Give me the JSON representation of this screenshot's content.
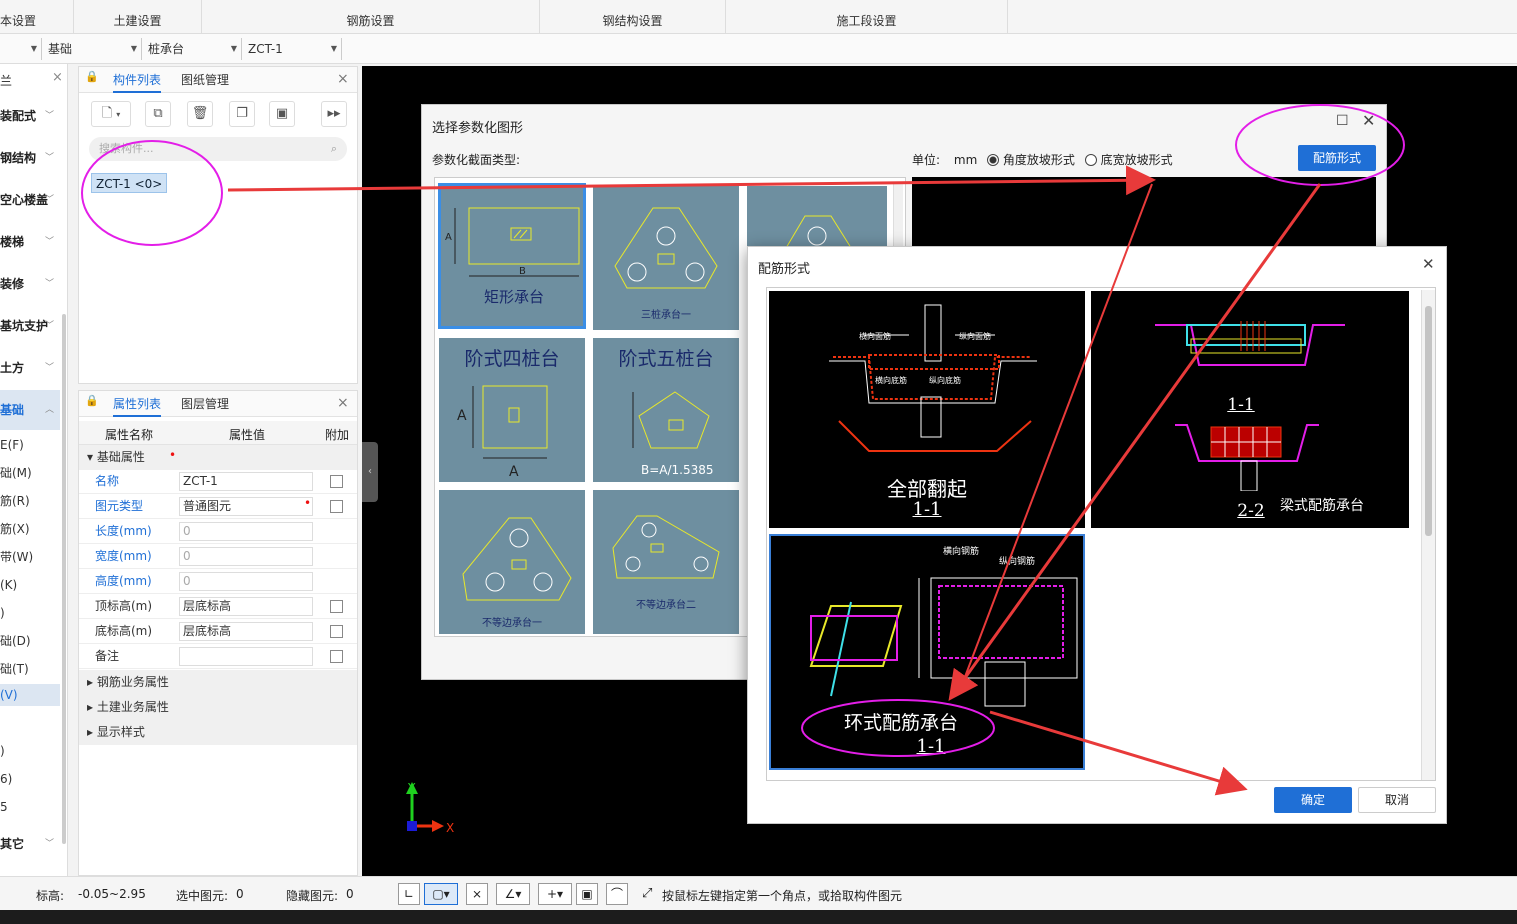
{
  "top_tabs": [
    "本设置",
    "土建设置",
    "钢筋设置",
    "钢结构设置",
    "施工段设置"
  ],
  "selectors": [
    "基础",
    "桩承台",
    "ZCT-1"
  ],
  "leftnav": {
    "headers": [
      "装配式",
      "钢结构",
      "空心楼盖",
      "楼梯",
      "装修",
      "基坑支护",
      "土方",
      "基础",
      "其它"
    ],
    "sub_items": [
      "E(F)",
      "础(M)",
      "筋(R)",
      "筋(X)",
      "带(W)",
      "(K)",
      ")",
      "础(D)",
      "础(T)",
      "(V)",
      ")",
      "6)",
      "5"
    ],
    "active_sub": "(V)"
  },
  "comp_panel": {
    "tabs": [
      "构件列表",
      "图纸管理"
    ],
    "search_placeholder": "搜索构件...",
    "item": "ZCT-1 <0>"
  },
  "prop_panel": {
    "tabs": [
      "属性列表",
      "图层管理"
    ],
    "columns": [
      "属性名称",
      "属性值",
      "附加"
    ],
    "group_basic": "基础属性",
    "rows": [
      {
        "name": "名称",
        "value": "ZCT-1"
      },
      {
        "name": "图元类型",
        "value": "普通图元"
      },
      {
        "name": "长度(mm)",
        "value": "0"
      },
      {
        "name": "宽度(mm)",
        "value": "0"
      },
      {
        "name": "高度(mm)",
        "value": "0"
      },
      {
        "name": "顶标高(m)",
        "value": "层底标高"
      },
      {
        "name": "底标高(m)",
        "value": "层底标高"
      },
      {
        "name": "备注",
        "value": ""
      }
    ],
    "groups": [
      "钢筋业务属性",
      "土建业务属性",
      "显示样式"
    ]
  },
  "status": {
    "elev_label": "标高:",
    "elev_value": "-0.05~2.95",
    "sel_label": "选中图元:",
    "sel_value": "0",
    "hidden_label": "隐藏图元:",
    "hidden_value": "0",
    "hint": "按鼠标左键指定第一个角点，或拾取构件图元"
  },
  "dialog_param": {
    "title": "选择参数化图形",
    "section_label": "参数化截面类型:",
    "unit_label": "单位:",
    "unit_value": "mm",
    "radio_a": "角度放坡形式",
    "radio_b": "底宽放坡形式",
    "rebar_button": "配筋形式",
    "cells": [
      {
        "title": "矩形承台",
        "dim_a": "A",
        "dim_b": "B"
      },
      {
        "title": "三桩承台一"
      },
      {
        "title": ""
      },
      {
        "title": "阶式四桩台",
        "dim_a": "A",
        "dim_b": "A"
      },
      {
        "title": "阶式五桩台",
        "dim_b": "B=A/1.5385"
      },
      {
        "title": "不等边承台一"
      },
      {
        "title": "不等边承台二"
      }
    ]
  },
  "dialog_rebar": {
    "title": "配筋形式",
    "panels": [
      {
        "title": "全部翻起",
        "section": "1-1"
      },
      {
        "title": "梁式配筋承台",
        "section_top": "1-1",
        "section_bottom": "2-2"
      },
      {
        "title": "环式配筋承台",
        "section": "1-1"
      }
    ],
    "ok": "确定",
    "cancel": "取消"
  },
  "axis": {
    "x": "X",
    "y": "Y"
  },
  "colors": {
    "accent": "#1f6fd6",
    "annotation": "#e31ee8",
    "arrow": "#e83a3a",
    "cell_bg": "#6e8fa0"
  }
}
